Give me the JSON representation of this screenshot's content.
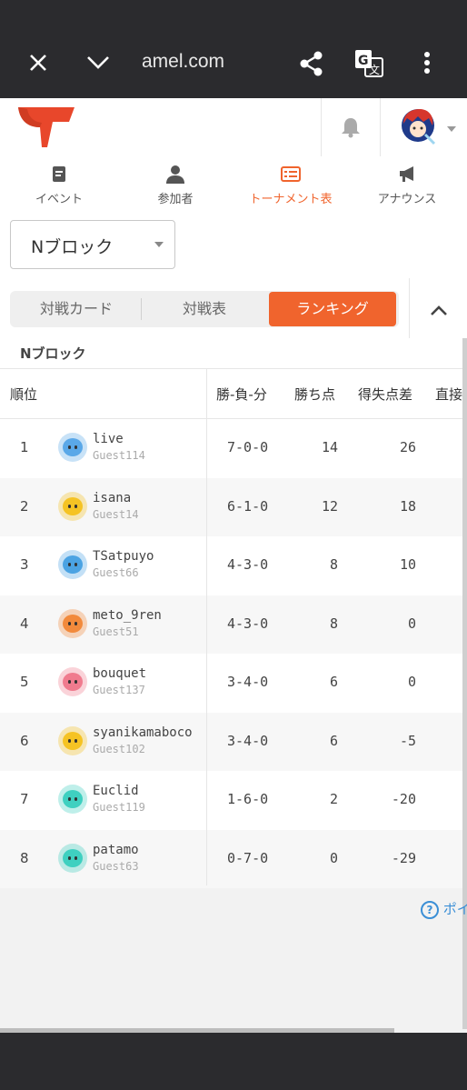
{
  "browser": {
    "url": "amel.com",
    "close_icon": "close-icon",
    "menu_icon": "chevron-down-icon",
    "share_icon": "share-icon",
    "translate_icon": "translate-icon",
    "more_icon": "more-vertical-icon"
  },
  "nav": {
    "items": [
      {
        "label": "イベント",
        "icon": "document-icon"
      },
      {
        "label": "参加者",
        "icon": "person-icon"
      },
      {
        "label": "トーナメント表",
        "icon": "bracket-icon",
        "active": true
      },
      {
        "label": "アナウンス",
        "icon": "megaphone-icon"
      }
    ]
  },
  "block_select": {
    "value": "Nブロック"
  },
  "view_tabs": [
    "対戦カード",
    "対戦表",
    "ランキング"
  ],
  "active_tab": "ランキング",
  "block_title": "Nブロック",
  "table": {
    "headers": {
      "rank": "順位",
      "record": "勝-負-分",
      "points": "勝ち点",
      "diff": "得失点差",
      "direct": "直接"
    },
    "rows": [
      {
        "rank": "1",
        "name": "live",
        "guest": "Guest114",
        "record": "7-0-0",
        "points": "14",
        "diff": "26",
        "avatar_color": "#5aa8e8"
      },
      {
        "rank": "2",
        "name": "isana",
        "guest": "Guest14",
        "record": "6-1-0",
        "points": "12",
        "diff": "18",
        "avatar_color": "#f5c324"
      },
      {
        "rank": "3",
        "name": "TSatpuyo",
        "guest": "Guest66",
        "record": "4-3-0",
        "points": "8",
        "diff": "10",
        "avatar_color": "#4ba3e3"
      },
      {
        "rank": "4",
        "name": "meto_9ren",
        "guest": "Guest51",
        "record": "4-3-0",
        "points": "8",
        "diff": "0",
        "avatar_color": "#f28a3c"
      },
      {
        "rank": "5",
        "name": "bouquet",
        "guest": "Guest137",
        "record": "3-4-0",
        "points": "6",
        "diff": "0",
        "avatar_color": "#f07b8e"
      },
      {
        "rank": "6",
        "name": "syanikamaboco",
        "guest": "Guest102",
        "record": "3-4-0",
        "points": "6",
        "diff": "-5",
        "avatar_color": "#f5c324"
      },
      {
        "rank": "7",
        "name": "Euclid",
        "guest": "Guest119",
        "record": "1-6-0",
        "points": "2",
        "diff": "-20",
        "avatar_color": "#3fd0c0"
      },
      {
        "rank": "8",
        "name": "patamo",
        "guest": "Guest63",
        "record": "0-7-0",
        "points": "0",
        "diff": "-29",
        "avatar_color": "#3fd0c0"
      }
    ]
  },
  "help_text": "ポイ",
  "colors": {
    "accent": "#f0642d",
    "logo": "#e8472b",
    "topbar": "#2b2b2e"
  }
}
